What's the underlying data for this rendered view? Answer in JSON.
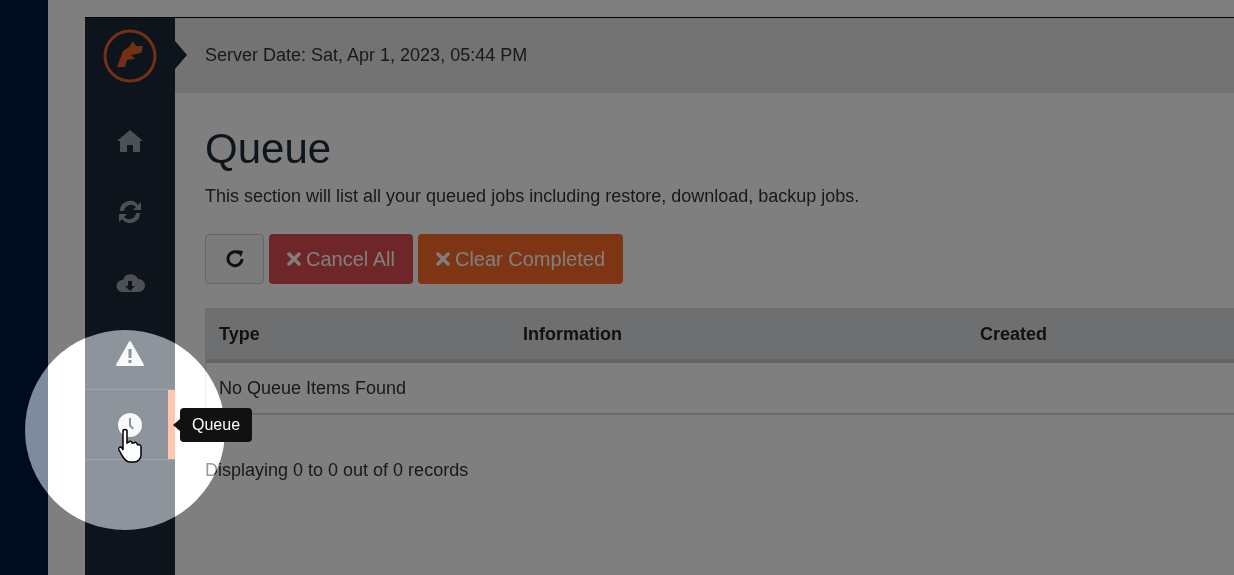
{
  "header": {
    "server_date": "Server Date: Sat, Apr 1, 2023, 05:44 PM"
  },
  "sidebar": {
    "items": [
      {
        "kind": "home",
        "selected": false
      },
      {
        "kind": "sync",
        "selected": false
      },
      {
        "kind": "download",
        "selected": false
      },
      {
        "kind": "alert",
        "selected": false
      },
      {
        "kind": "queue",
        "selected": true,
        "tooltip": "Queue"
      }
    ]
  },
  "page": {
    "title": "Queue",
    "description": "This section will list all your queued jobs including restore, download, backup jobs."
  },
  "toolbar": {
    "buttons": [
      {
        "kind": "refresh"
      },
      {
        "kind": "danger",
        "label": "Cancel All"
      },
      {
        "kind": "warning",
        "label": "Clear Completed"
      }
    ]
  },
  "table": {
    "columns": [
      "Type",
      "Information",
      "Created"
    ],
    "empty_message": "No Queue Items Found"
  },
  "footer": {
    "records": "Displaying 0 to 0 out of 0 records"
  }
}
